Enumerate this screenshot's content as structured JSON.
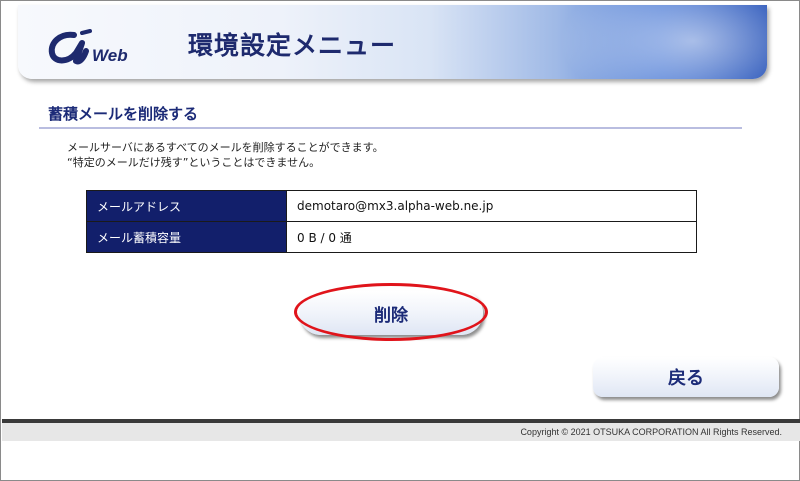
{
  "header": {
    "logo_text": "Web",
    "title": "環境設定メニュー"
  },
  "section": {
    "title": "蓄積メールを削除する",
    "description_line1": "メールサーバにあるすべてのメールを削除することができます。",
    "description_line2": "“特定のメールだけ残す”ということはできません。"
  },
  "info": {
    "rows": [
      {
        "label": "メールアドレス",
        "value": "demotaro@mx3.alpha-web.ne.jp"
      },
      {
        "label": "メール蓄積容量",
        "value": "0 B / 0 通"
      }
    ]
  },
  "buttons": {
    "delete_label": "削除",
    "back_label": "戻る"
  },
  "footer": {
    "copyright": "Copyright © 2021 OTSUKA CORPORATION All Rights Reserved."
  },
  "colors": {
    "accent_navy": "#121f6b",
    "title_blue": "#1c2b78",
    "highlight_red": "#e0141b"
  }
}
